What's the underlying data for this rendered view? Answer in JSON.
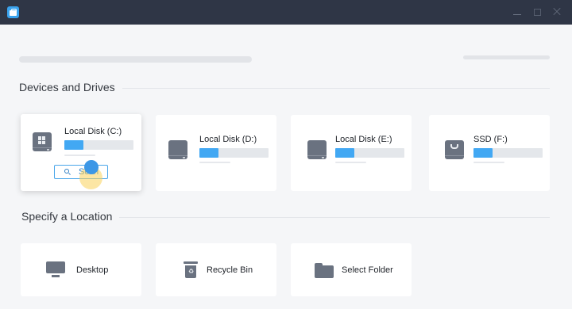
{
  "titlebar": {
    "app_icon": "toolbox-icon",
    "controls": [
      "minimize-icon",
      "maximize-icon",
      "close-icon"
    ]
  },
  "sections": {
    "devices_title": "Devices and Drives",
    "location_title": "Specify a Location"
  },
  "drives": [
    {
      "label": "Local Disk (C:)",
      "icon": "windows-drive-icon",
      "usage_fraction": 0.28,
      "selected": true
    },
    {
      "label": "Local Disk (D:)",
      "icon": "drive-icon",
      "usage_fraction": 0.28
    },
    {
      "label": "Local Disk (E:)",
      "icon": "drive-icon",
      "usage_fraction": 0.28
    },
    {
      "label": "SSD (F:)",
      "icon": "ssd-drive-icon",
      "usage_fraction": 0.28
    }
  ],
  "scan_button": {
    "label": "Scan",
    "icon": "search-icon"
  },
  "locations": [
    {
      "label": "Desktop",
      "icon": "monitor-icon"
    },
    {
      "label": "Recycle Bin",
      "icon": "recycle-bin-icon"
    },
    {
      "label": "Select Folder",
      "icon": "folder-icon"
    }
  ],
  "colors": {
    "titlebar": "#2f3646",
    "accent": "#42a8f3",
    "background": "#f5f6f8",
    "card": "#ffffff",
    "icon": "#6a7280"
  }
}
